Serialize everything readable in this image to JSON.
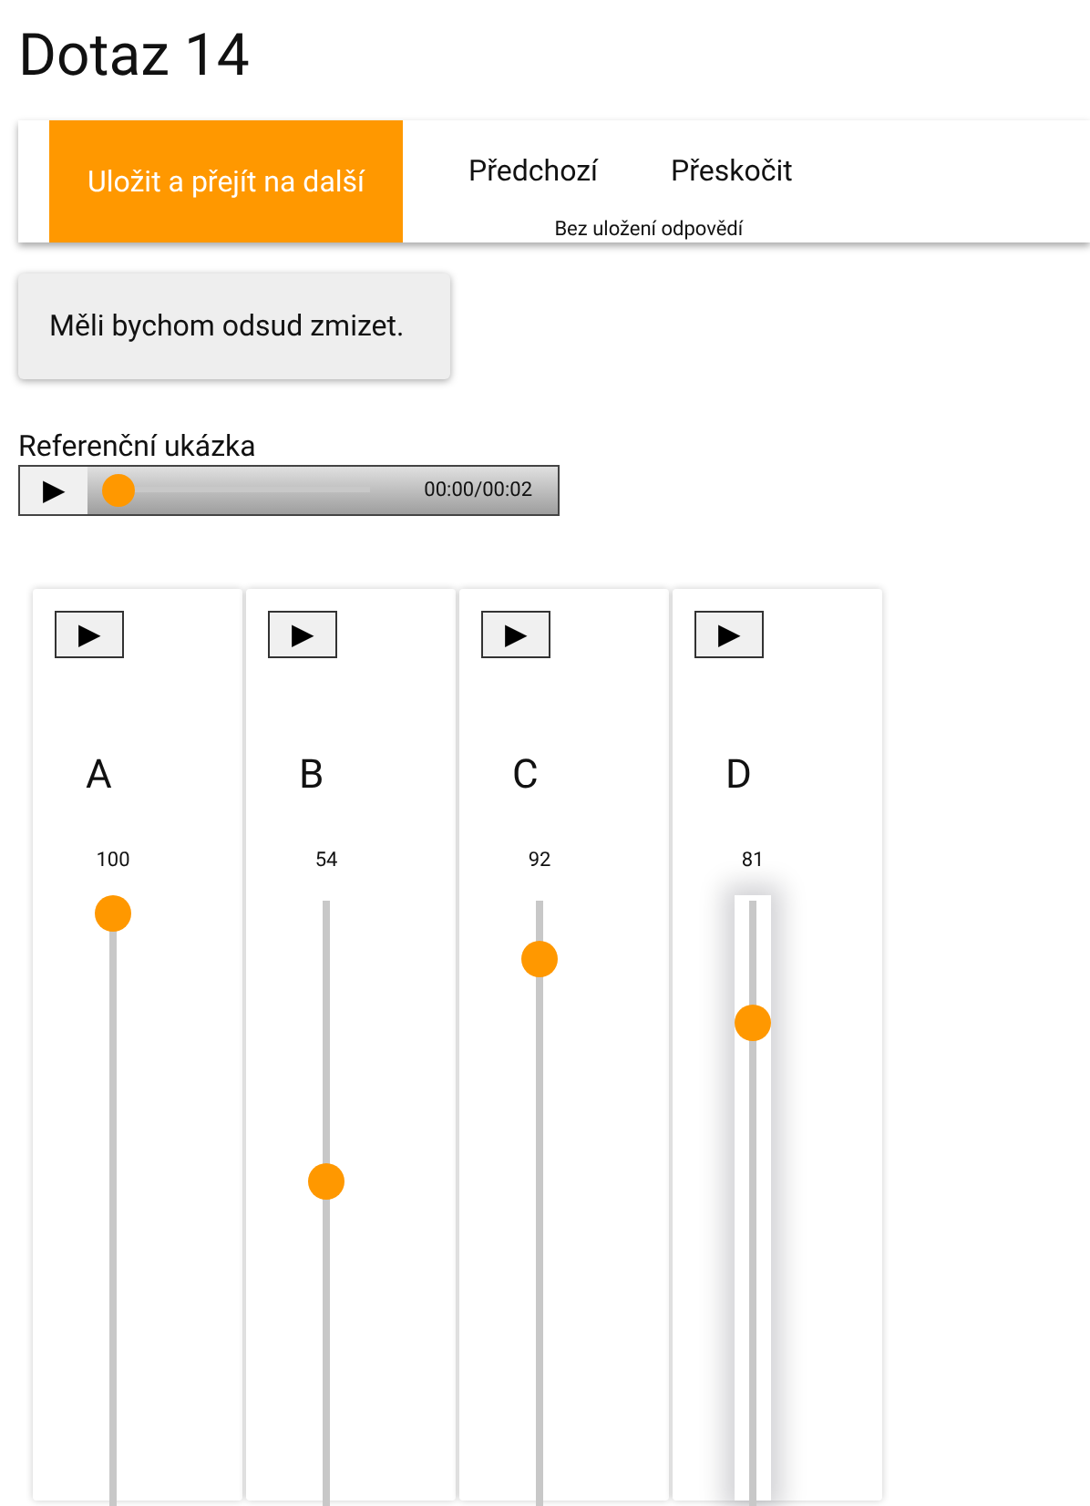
{
  "title": "Dotaz 14",
  "nav": {
    "primary": "Uložit a přejít na další",
    "previous": "Předchozí",
    "skip": "Přeskočit",
    "skip_note": "Bez uložení odpovědí"
  },
  "message": "Měli bychom odsud zmizet.",
  "reference": {
    "label": "Referenční ukázka",
    "play": "▶",
    "level": 0,
    "time": "00:00/00:02"
  },
  "samples": [
    {
      "play": "▶",
      "name": "A",
      "value": "100",
      "level": 1.0,
      "focused": false
    },
    {
      "play": "▶",
      "name": "B",
      "value": "54",
      "level": 0.54,
      "focused": false
    },
    {
      "play": "▶",
      "name": "C",
      "value": "92",
      "level": 0.92,
      "focused": false
    },
    {
      "play": "▶",
      "name": "D",
      "value": "81",
      "level": 0.81,
      "focused": true
    }
  ]
}
